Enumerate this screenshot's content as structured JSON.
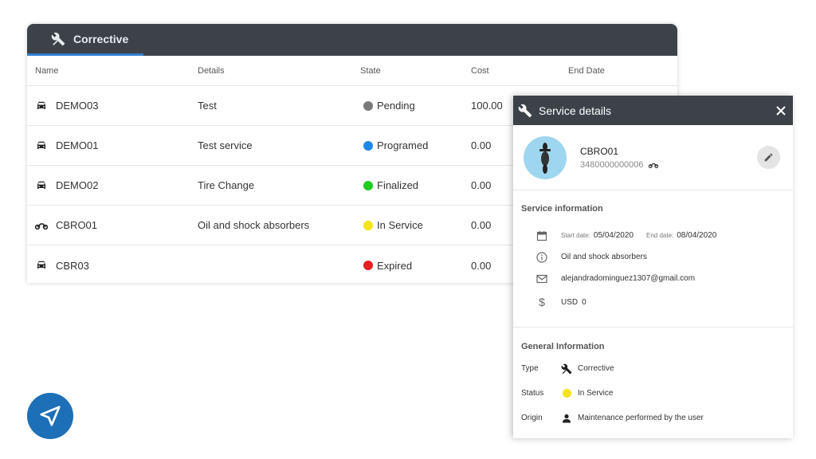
{
  "tab": {
    "label": "Corrective",
    "icon": "tools-icon"
  },
  "table": {
    "columns": [
      "Name",
      "Details",
      "State",
      "Cost",
      "End Date"
    ],
    "rows": [
      {
        "name": "DEMO03",
        "vehicle": "car",
        "details": "Test",
        "state": "Pending",
        "state_color": "#7a7a7a",
        "cost": "100.00"
      },
      {
        "name": "DEMO01",
        "vehicle": "car",
        "details": "Test service",
        "state": "Programed",
        "state_color": "#1e88e5",
        "cost": "0.00"
      },
      {
        "name": "DEMO02",
        "vehicle": "car",
        "details": "Tire Change",
        "state": "Finalized",
        "state_color": "#22cc22",
        "cost": "0.00"
      },
      {
        "name": "CBRO01",
        "vehicle": "motorcycle",
        "details": "Oil and shock absorbers",
        "state": "In Service",
        "state_color": "#f4e41a",
        "cost": "0.00"
      },
      {
        "name": "CBR03",
        "vehicle": "car",
        "details": "",
        "state": "Expired",
        "state_color": "#e62020",
        "cost": "0.00"
      }
    ]
  },
  "panel": {
    "title": "Service details",
    "vehicle": {
      "name": "CBRO01",
      "id": "3480000000006"
    },
    "service": {
      "heading": "Service information",
      "start_label": "Start date:",
      "start_date": "05/04/2020",
      "end_label": "End date:",
      "end_date": "08/04/2020",
      "description": "Oil and shock absorbers",
      "email": "alejandradominguez1307@gmail.com",
      "currency": "USD",
      "amount": "0"
    },
    "general": {
      "heading": "General Information",
      "type_label": "Type",
      "type_value": "Corrective",
      "status_label": "Status",
      "status_value": "In Service",
      "status_color": "#f4e41a",
      "origin_label": "Origin",
      "origin_value": "Maintenance performed by the user"
    }
  },
  "colors": {
    "header": "#3c4248",
    "accent": "#2f7fd1",
    "fab": "#1d6fb8"
  }
}
